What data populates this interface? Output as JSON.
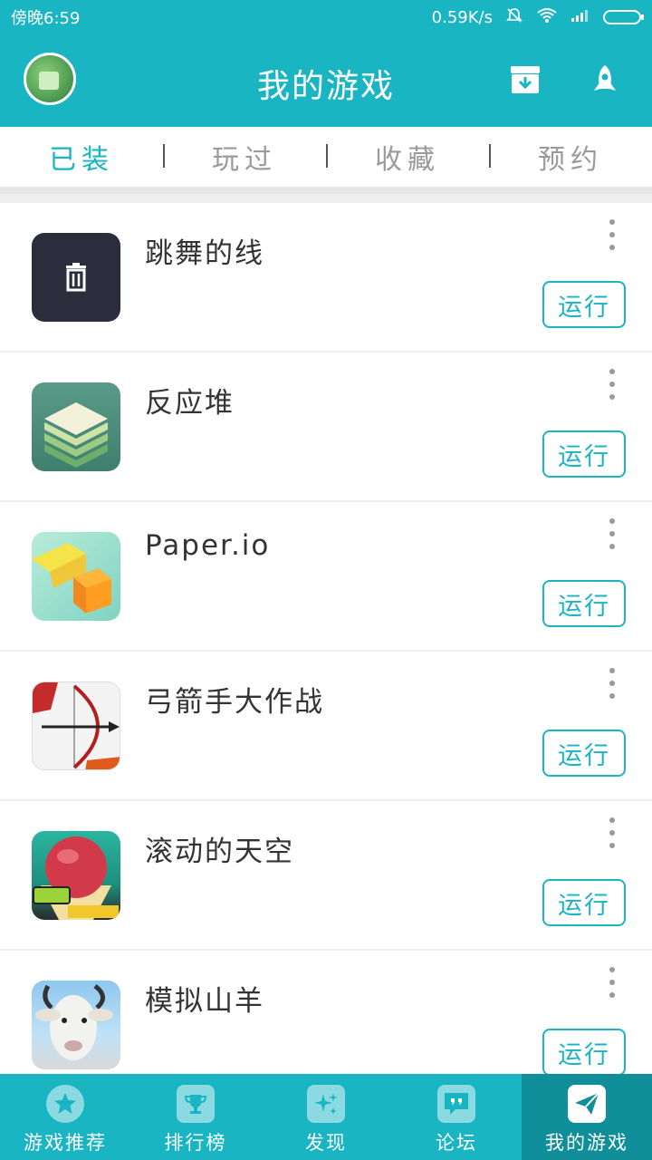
{
  "status_bar": {
    "time": "傍晚6:59",
    "net_speed": "0.59K/s"
  },
  "header": {
    "title": "我的游戏",
    "download_icon": "download-box-icon",
    "rocket_icon": "rocket-icon"
  },
  "tabs": [
    {
      "label": "已装",
      "active": true
    },
    {
      "label": "玩过",
      "active": false
    },
    {
      "label": "收藏",
      "active": false
    },
    {
      "label": "预约",
      "active": false
    }
  ],
  "games": [
    {
      "name": "跳舞的线",
      "button": "运行",
      "icon": "trash-icon"
    },
    {
      "name": "反应堆",
      "button": "运行",
      "icon": "stack-game-icon"
    },
    {
      "name": "Paper.io",
      "button": "运行",
      "icon": "paper-io-icon"
    },
    {
      "name": "弓箭手大作战",
      "button": "运行",
      "icon": "archer-game-icon"
    },
    {
      "name": "滚动的天空",
      "button": "运行",
      "icon": "rolling-sky-icon"
    },
    {
      "name": "模拟山羊",
      "button": "运行",
      "icon": "goat-simulator-icon"
    }
  ],
  "bottom_nav": [
    {
      "label": "游戏推荐",
      "icon": "star-icon",
      "active": false
    },
    {
      "label": "排行榜",
      "icon": "trophy-icon",
      "active": false
    },
    {
      "label": "发现",
      "icon": "sparkle-icon",
      "active": false
    },
    {
      "label": "论坛",
      "icon": "chat-quote-icon",
      "active": false
    },
    {
      "label": "我的游戏",
      "icon": "paper-plane-icon",
      "active": true
    }
  ],
  "colors": {
    "accent": "#19b5c3",
    "active_nav": "#108f9a"
  }
}
